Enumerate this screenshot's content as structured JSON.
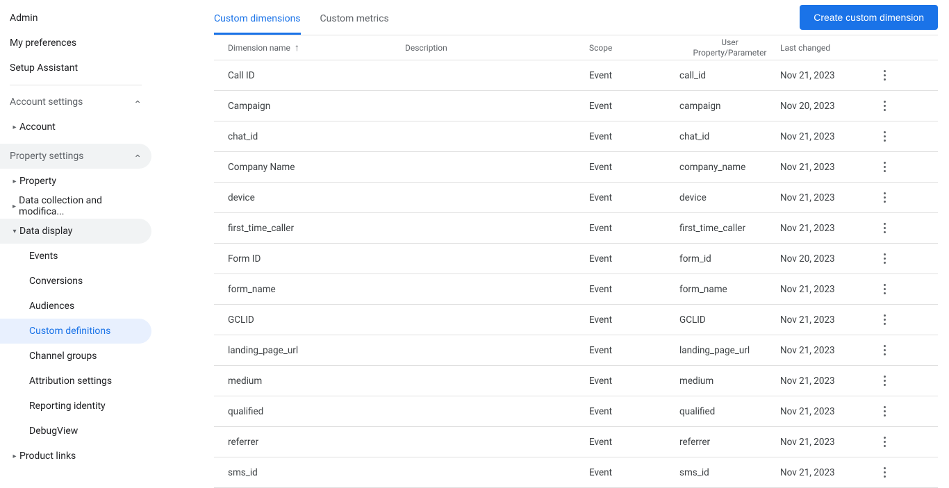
{
  "sidebar": {
    "admin": "Admin",
    "my_preferences": "My preferences",
    "setup_assistant": "Setup Assistant",
    "account_settings": "Account settings",
    "account": "Account",
    "property_settings": "Property settings",
    "property": "Property",
    "data_collection": "Data collection and modifica...",
    "data_display": "Data display",
    "events": "Events",
    "conversions": "Conversions",
    "audiences": "Audiences",
    "custom_definitions": "Custom definitions",
    "channel_groups": "Channel groups",
    "attribution_settings": "Attribution settings",
    "reporting_identity": "Reporting identity",
    "debugview": "DebugView",
    "product_links": "Product links"
  },
  "tabs": {
    "custom_dimensions": "Custom dimensions",
    "custom_metrics": "Custom metrics"
  },
  "button": {
    "create": "Create custom dimension"
  },
  "columns": {
    "name": "Dimension name",
    "description": "Description",
    "scope": "Scope",
    "param_line1": "User",
    "param_line2": "Property/Parameter",
    "last_changed": "Last changed"
  },
  "rows": [
    {
      "name": "Call ID",
      "description": "",
      "scope": "Event",
      "param": "call_id",
      "last_changed": "Nov 21, 2023"
    },
    {
      "name": "Campaign",
      "description": "",
      "scope": "Event",
      "param": "campaign",
      "last_changed": "Nov 20, 2023"
    },
    {
      "name": "chat_id",
      "description": "",
      "scope": "Event",
      "param": "chat_id",
      "last_changed": "Nov 21, 2023"
    },
    {
      "name": "Company Name",
      "description": "",
      "scope": "Event",
      "param": "company_name",
      "last_changed": "Nov 21, 2023"
    },
    {
      "name": "device",
      "description": "",
      "scope": "Event",
      "param": "device",
      "last_changed": "Nov 21, 2023"
    },
    {
      "name": "first_time_caller",
      "description": "",
      "scope": "Event",
      "param": "first_time_caller",
      "last_changed": "Nov 21, 2023"
    },
    {
      "name": "Form ID",
      "description": "",
      "scope": "Event",
      "param": "form_id",
      "last_changed": "Nov 20, 2023"
    },
    {
      "name": "form_name",
      "description": "",
      "scope": "Event",
      "param": "form_name",
      "last_changed": "Nov 21, 2023"
    },
    {
      "name": "GCLID",
      "description": "",
      "scope": "Event",
      "param": "GCLID",
      "last_changed": "Nov 21, 2023"
    },
    {
      "name": "landing_page_url",
      "description": "",
      "scope": "Event",
      "param": "landing_page_url",
      "last_changed": "Nov 21, 2023"
    },
    {
      "name": "medium",
      "description": "",
      "scope": "Event",
      "param": "medium",
      "last_changed": "Nov 21, 2023"
    },
    {
      "name": "qualified",
      "description": "",
      "scope": "Event",
      "param": "qualified",
      "last_changed": "Nov 21, 2023"
    },
    {
      "name": "referrer",
      "description": "",
      "scope": "Event",
      "param": "referrer",
      "last_changed": "Nov 21, 2023"
    },
    {
      "name": "sms_id",
      "description": "",
      "scope": "Event",
      "param": "sms_id",
      "last_changed": "Nov 21, 2023"
    }
  ]
}
